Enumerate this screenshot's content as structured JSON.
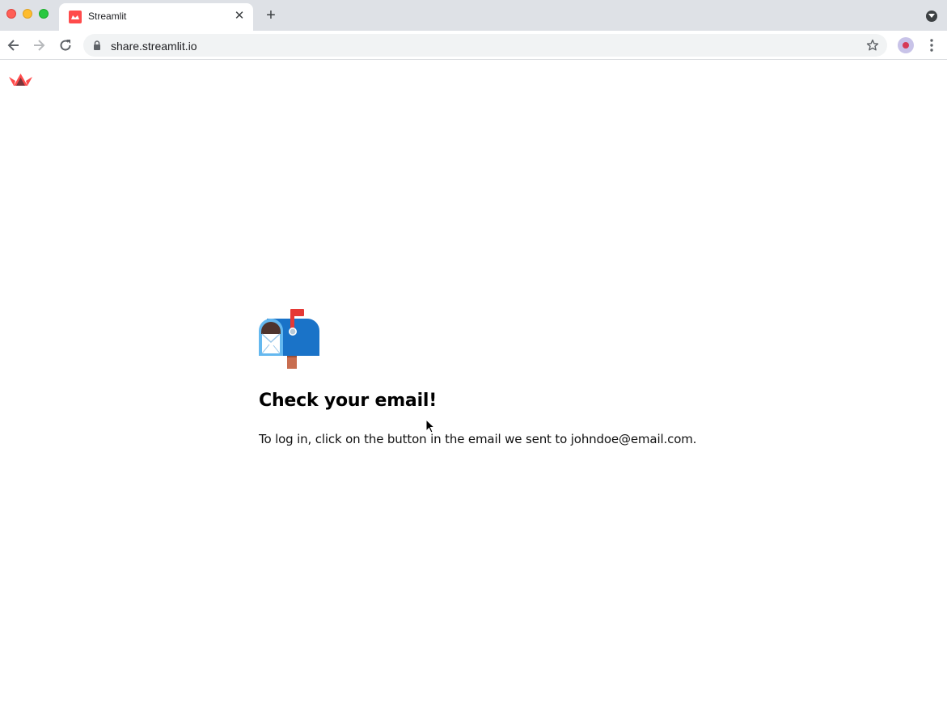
{
  "browser": {
    "tab": {
      "title": "Streamlit",
      "close_glyph": "✕",
      "favicon": "streamlit-logo-icon"
    },
    "new_tab_glyph": "+",
    "address_bar": {
      "url": "share.streamlit.io"
    },
    "icons": {
      "back": "back-arrow-icon",
      "forward": "forward-arrow-icon",
      "reload": "reload-icon",
      "lock": "lock-icon",
      "bookmark": "star-icon",
      "menu": "kebab-menu-icon"
    }
  },
  "page": {
    "logo": "streamlit-crown-logo",
    "illustration": "mailbox-with-raised-flag-icon",
    "heading": "Check your email!",
    "message": "To log in, click on the button in the email we sent to johndoe@email.com."
  },
  "colors": {
    "brand": "#ff4b4b",
    "tabbar_bg": "#dee1e6",
    "omnibox_bg": "#f1f3f4",
    "mailbox_blue": "#1a73c8",
    "flag_red": "#e53935"
  }
}
